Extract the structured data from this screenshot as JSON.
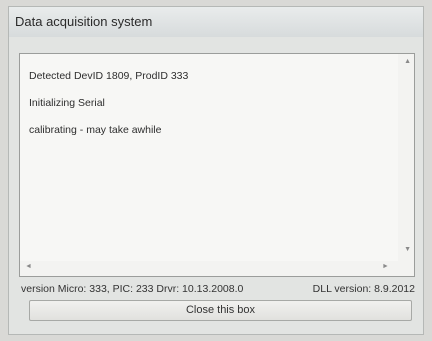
{
  "window": {
    "title": "Data acquisition system"
  },
  "log": {
    "lines": [
      "Detected DevID 1809,  ProdID 333",
      "Initializing Serial",
      "calibrating - may take awhile"
    ]
  },
  "status": {
    "version_info": "version Micro: 333,   PIC: 233  Drvr: 10.13.2008.0",
    "dll_version": "DLL version:  8.9.2012"
  },
  "buttons": {
    "close_label": "Close this box"
  },
  "icons": {
    "scroll_up": "scroll-up-arrow-icon",
    "scroll_down": "scroll-down-arrow-icon",
    "scroll_left": "scroll-left-arrow-icon",
    "scroll_right": "scroll-right-arrow-icon"
  }
}
